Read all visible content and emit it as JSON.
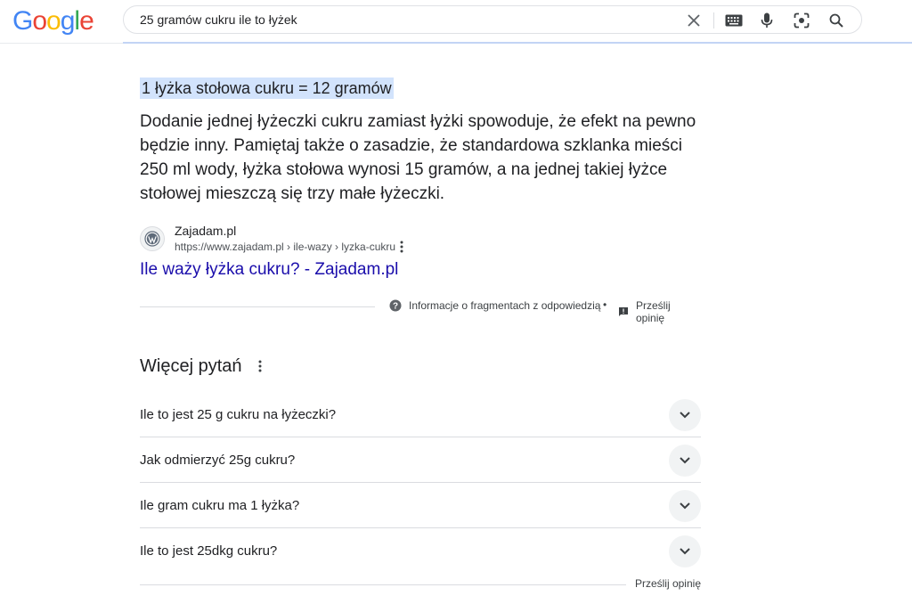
{
  "logo": {
    "letters": [
      "G",
      "o",
      "o",
      "g",
      "l",
      "e"
    ],
    "colors": [
      "#4285f4",
      "#ea4335",
      "#fbbc05",
      "#4285f4",
      "#34a853",
      "#ea4335"
    ]
  },
  "search": {
    "query": "25 gramów cukru ile to łyżek",
    "icons": [
      "close-icon",
      "keyboard-icon",
      "microphone-icon",
      "lens-icon",
      "search-icon"
    ]
  },
  "featured_snippet": {
    "answer": "1 łyżka stołowa cukru = 12 gramów",
    "body": "Dodanie jednej łyżeczki cukru zamiast łyżki spowoduje, że efekt na pewno będzie inny. Pamiętaj także o zasadzie, że standardowa szklanka mieści 250 ml wody, łyżka stołowa wynosi 15 gramów, a na jednej takiej łyżce stołowej mieszczą się trzy małe łyżeczki.",
    "source": {
      "site_name": "Zajadam.pl",
      "url": "https://www.zajadam.pl › ile-wazy › lyzka-cukru",
      "link_title": "Ile waży łyżka cukru? - Zajadam.pl",
      "favicon": "wordpress-icon"
    },
    "footer": {
      "info_label": "Informacje o fragmentach z odpowiedzią",
      "separator": "•",
      "feedback_label": "Prześlij opinię"
    }
  },
  "related_questions": {
    "title": "Więcej pytań",
    "items": [
      {
        "question": "Ile to jest 25 g cukru na łyżeczki?"
      },
      {
        "question": "Jak odmierzyć 25g cukru?"
      },
      {
        "question": "Ile gram cukru ma 1 łyżka?"
      },
      {
        "question": "Ile to jest 25dkg cukru?"
      }
    ],
    "feedback_label": "Prześlij opinię"
  },
  "colors": {
    "link": "#1a0dab",
    "highlight": "#d2e3fc",
    "text": "#202124",
    "muted": "#4d5156"
  }
}
